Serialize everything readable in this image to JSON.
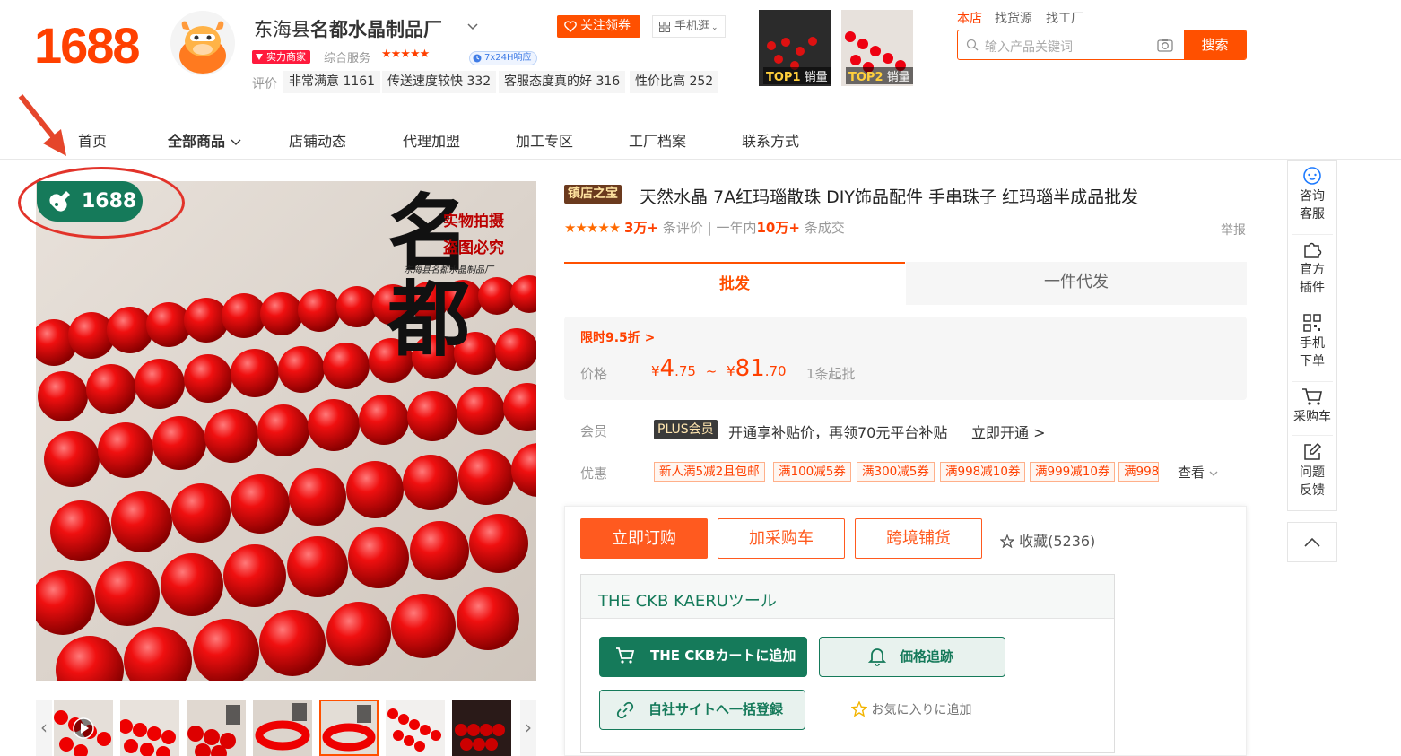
{
  "header": {
    "logo": "1688",
    "shop_name_prefix": "东海县",
    "shop_name_bold": "名都水晶制品厂",
    "badge_shili": "实力商家",
    "service_label": "综合服务",
    "service_stars": "★★★★★",
    "badge_24h": "7x24H响应",
    "rating_label": "评价",
    "ratings": [
      "非常满意 1161",
      "传送速度较快 332",
      "客服态度真的好 316",
      "性价比高 252"
    ],
    "follow_btn": "关注领券",
    "mobile_btn": "手机逛",
    "top_thumbs": [
      {
        "rank": "TOP1",
        "label": "销量"
      },
      {
        "rank": "TOP2",
        "label": "销量"
      }
    ],
    "search_scopes": [
      "本店",
      "找货源",
      "找工厂"
    ],
    "search_placeholder": "输入产品关键词",
    "search_btn": "搜索"
  },
  "nav": {
    "items": [
      "首页",
      "全部商品",
      "店铺动态",
      "代理加盟",
      "加工专区",
      "工厂档案",
      "联系方式"
    ]
  },
  "gallery": {
    "badge": "1688",
    "watermark_big": "名都",
    "watermark_small1": "实物拍摄",
    "watermark_small2": "盗图必究",
    "watermark_sub": "东海县名都水晶制品厂"
  },
  "product": {
    "tag": "镇店之宝",
    "title": "天然水晶 7A红玛瑙散珠 DIY饰品配件 手串珠子 红玛瑙半成品批发",
    "stars": "★★★★★",
    "reviews_num": "3万+",
    "reviews_label": "条评价",
    "sold_prefix": "一年内",
    "sold_num": "10万+",
    "sold_label": "条成交",
    "report": "举报",
    "tab_wholesale": "批发",
    "tab_dropship": "一件代发",
    "promo": "限时9.5折 >",
    "price_label": "价格",
    "price_low_int": "4",
    "price_low_dec": ".75",
    "price_sep": "~",
    "price_high_int": "81",
    "price_high_dec": ".70",
    "currency": "¥",
    "min_qty": "1条起批",
    "member_label": "会员",
    "plus_badge": "PLUS会员",
    "plus_text": "开通享补贴价，再领70元平台补贴",
    "plus_open": "立即开通 >",
    "coupon_label": "优惠",
    "coupons": [
      "新人满5减2且包邮",
      "满100减5券",
      "满300减5券",
      "满998减10券",
      "满999减10券",
      "满998"
    ],
    "coupon_more": "查看",
    "btn_buy": "立即订购",
    "btn_cart": "加采购车",
    "btn_cross": "跨境铺货",
    "fav": "收藏(5236)"
  },
  "ckb": {
    "title": "THE CKB KAERUツール",
    "btn_cart": "THE CKBカートに追加",
    "btn_price": "価格追跡",
    "btn_bulk": "自社サイトへ一括登録",
    "fav": "お気に入りに追加"
  },
  "sidebar": {
    "items": [
      "咨询\n客服",
      "官方\n插件",
      "手机\n下单",
      "采购车",
      "问题\n反馈"
    ]
  },
  "colors": {
    "brand": "#ff5000",
    "ckb_green": "#157a5a"
  }
}
